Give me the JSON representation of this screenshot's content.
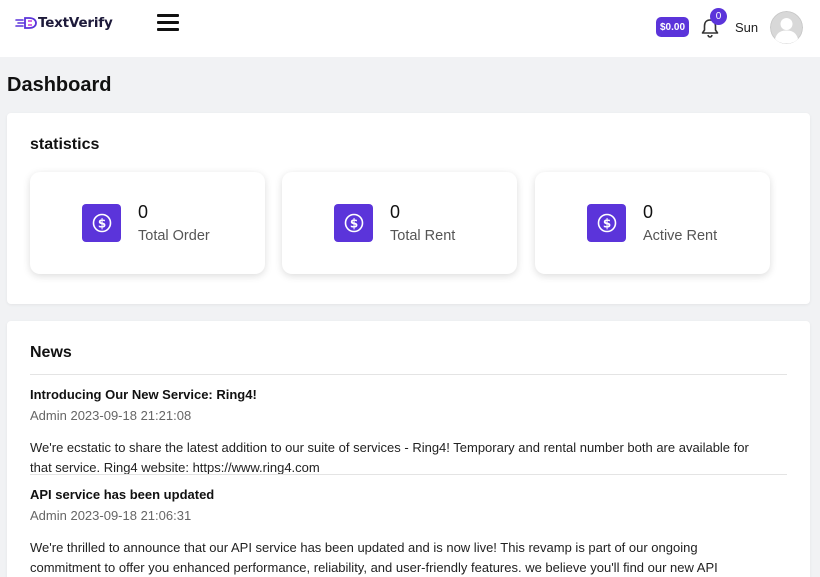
{
  "header": {
    "brand": "TextVerify",
    "balance": "$0.00",
    "notification_count": "0",
    "username": "Sun"
  },
  "page_title": "Dashboard",
  "statistics": {
    "title": "statistics",
    "items": [
      {
        "value": "0",
        "label": "Total Order",
        "icon": "dollar-icon"
      },
      {
        "value": "0",
        "label": "Total Rent",
        "icon": "dollar-icon"
      },
      {
        "value": "0",
        "label": "Active Rent",
        "icon": "dollar-icon"
      }
    ]
  },
  "news": {
    "title": "News",
    "items": [
      {
        "title": "Introducing Our New Service: Ring4!",
        "meta": "Admin 2023-09-18 21:21:08",
        "body": "We're ecstatic to share the latest addition to our suite of services - Ring4! Temporary and rental number both are available for that service. Ring4 website: https://www.ring4.com"
      },
      {
        "title": "API service has been updated",
        "meta": "Admin 2023-09-18 21:06:31",
        "body": "We're thrilled to announce that our API service has been updated and is now live! This revamp is part of our ongoing commitment to offer you enhanced performance, reliability, and user-friendly features. we believe you'll find our new API"
      }
    ]
  },
  "colors": {
    "accent": "#5b34da",
    "background": "#f1f2f4",
    "card": "#ffffff"
  }
}
